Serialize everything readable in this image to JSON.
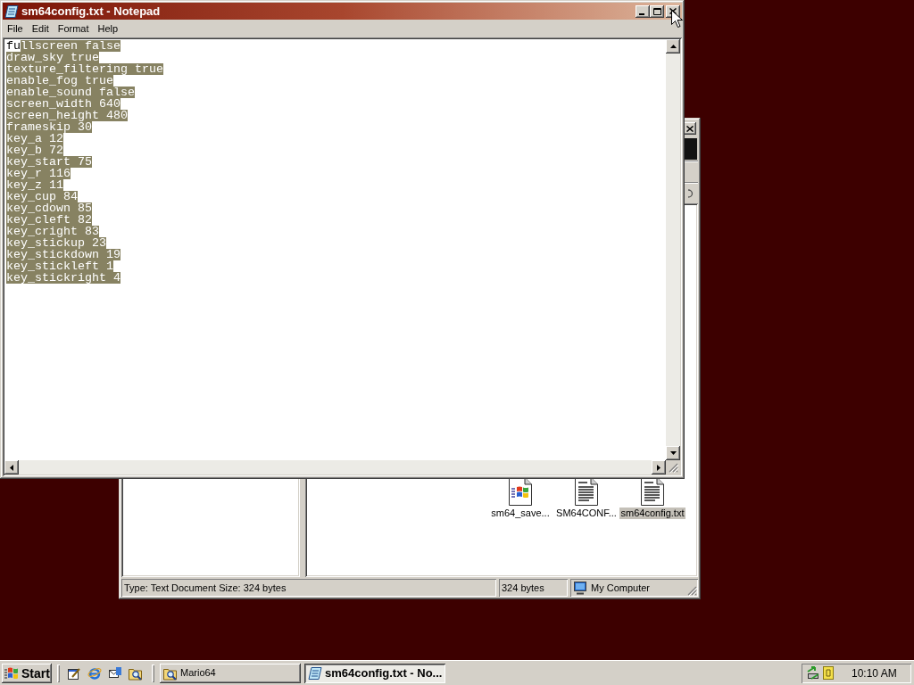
{
  "notepad": {
    "title": "sm64config.txt - Notepad",
    "active": true,
    "menu": [
      "File",
      "Edit",
      "Format",
      "Help"
    ],
    "lines": [
      {
        "spans": [
          {
            "text": "fu",
            "selected": false
          },
          {
            "text": "llscreen false",
            "selected": true
          }
        ]
      },
      {
        "spans": [
          {
            "text": "draw_sky true",
            "selected": true
          }
        ]
      },
      {
        "spans": [
          {
            "text": "texture_filtering true",
            "selected": true
          }
        ]
      },
      {
        "spans": [
          {
            "text": "enable_fog true",
            "selected": true
          }
        ]
      },
      {
        "spans": [
          {
            "text": "enable_sound false",
            "selected": true
          }
        ]
      },
      {
        "spans": [
          {
            "text": "screen_width 640",
            "selected": true
          }
        ]
      },
      {
        "spans": [
          {
            "text": "screen_height 480",
            "selected": true
          }
        ]
      },
      {
        "spans": [
          {
            "text": "frameskip 30",
            "selected": true
          }
        ]
      },
      {
        "spans": [
          {
            "text": "key_a 12",
            "selected": true
          }
        ]
      },
      {
        "spans": [
          {
            "text": "key_b 72",
            "selected": true
          }
        ]
      },
      {
        "spans": [
          {
            "text": "key_start 75",
            "selected": true
          }
        ]
      },
      {
        "spans": [
          {
            "text": "key_r 116",
            "selected": true
          }
        ]
      },
      {
        "spans": [
          {
            "text": "key_z 11",
            "selected": true
          }
        ]
      },
      {
        "spans": [
          {
            "text": "key_cup 84",
            "selected": true
          }
        ]
      },
      {
        "spans": [
          {
            "text": "key_cdown 85",
            "selected": true
          }
        ]
      },
      {
        "spans": [
          {
            "text": "key_cleft 82",
            "selected": true
          }
        ]
      },
      {
        "spans": [
          {
            "text": "key_cright 83",
            "selected": true
          }
        ]
      },
      {
        "spans": [
          {
            "text": "key_stickup 23",
            "selected": true
          }
        ]
      },
      {
        "spans": [
          {
            "text": "key_stickdown 19",
            "selected": true
          }
        ]
      },
      {
        "spans": [
          {
            "text": "key_stickleft 1",
            "selected": true
          }
        ]
      },
      {
        "spans": [
          {
            "text": "key_stickright 4",
            "selected": true
          }
        ]
      }
    ]
  },
  "explorer": {
    "active": false,
    "files": [
      {
        "name": "sm64_save...",
        "kind": "flag-document",
        "selected": false
      },
      {
        "name": "SM64CONF...",
        "kind": "text-document",
        "selected": false
      },
      {
        "name": "sm64config.txt",
        "kind": "text-document",
        "selected": true
      }
    ],
    "status_bar": [
      {
        "text": "Type: Text Document Size: 324 bytes",
        "kind": "text"
      },
      {
        "text": "324 bytes",
        "kind": "text"
      },
      {
        "text": "My Computer",
        "kind": "zone"
      }
    ]
  },
  "taskbar": {
    "start": "Start",
    "tasks": [
      {
        "label": "Mario64",
        "kind": "folder",
        "selected": false
      },
      {
        "label": "sm64config.txt - No...",
        "kind": "notepad",
        "selected": true
      }
    ],
    "clock": "10:10 AM"
  }
}
